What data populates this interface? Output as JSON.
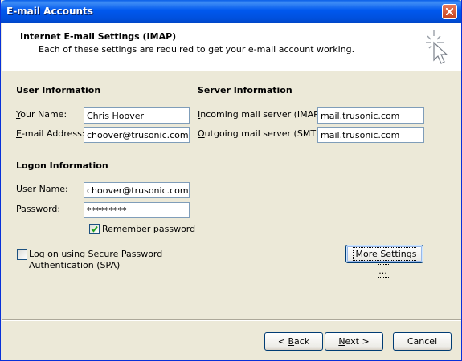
{
  "window": {
    "title": "E-mail Accounts"
  },
  "header": {
    "title": "Internet E-mail Settings (IMAP)",
    "subtitle": "Each of these settings are required to get your e-mail account working."
  },
  "user_info": {
    "heading": "User Information",
    "name_label_key": "Y",
    "name_label_rest": "our Name:",
    "name_value": "Chris Hoover",
    "email_label_key": "E",
    "email_label_rest": "-mail Address:",
    "email_value": "choover@trusonic.com"
  },
  "server_info": {
    "heading": "Server Information",
    "incoming_label_key": "I",
    "incoming_label_rest": "ncoming mail server (IMAP):",
    "incoming_value": "mail.trusonic.com",
    "outgoing_label_key": "O",
    "outgoing_label_rest": "utgoing mail server (SMTP):",
    "outgoing_value": "mail.trusonic.com"
  },
  "logon_info": {
    "heading": "Logon Information",
    "user_label_key": "U",
    "user_label_rest": "ser Name:",
    "user_value": "choover@trusonic.com",
    "password_label_key": "P",
    "password_label_rest": "assword:",
    "password_value": "*********",
    "remember_key": "R",
    "remember_rest": "emember password",
    "remember_checked": true,
    "spa_key": "L",
    "spa_line1_rest": "og on using Secure Password",
    "spa_line2": "Authentication (SPA)",
    "spa_checked": false
  },
  "buttons": {
    "more_settings": "More Settings ...",
    "back_key": "B",
    "back_rest": "ack",
    "back_prefix": "< ",
    "next_key": "N",
    "next_rest": "ext >",
    "cancel": "Cancel"
  },
  "colors": {
    "titlebar": "#0054e3",
    "dialog_bg": "#ece9d8",
    "close": "#d2532d"
  }
}
